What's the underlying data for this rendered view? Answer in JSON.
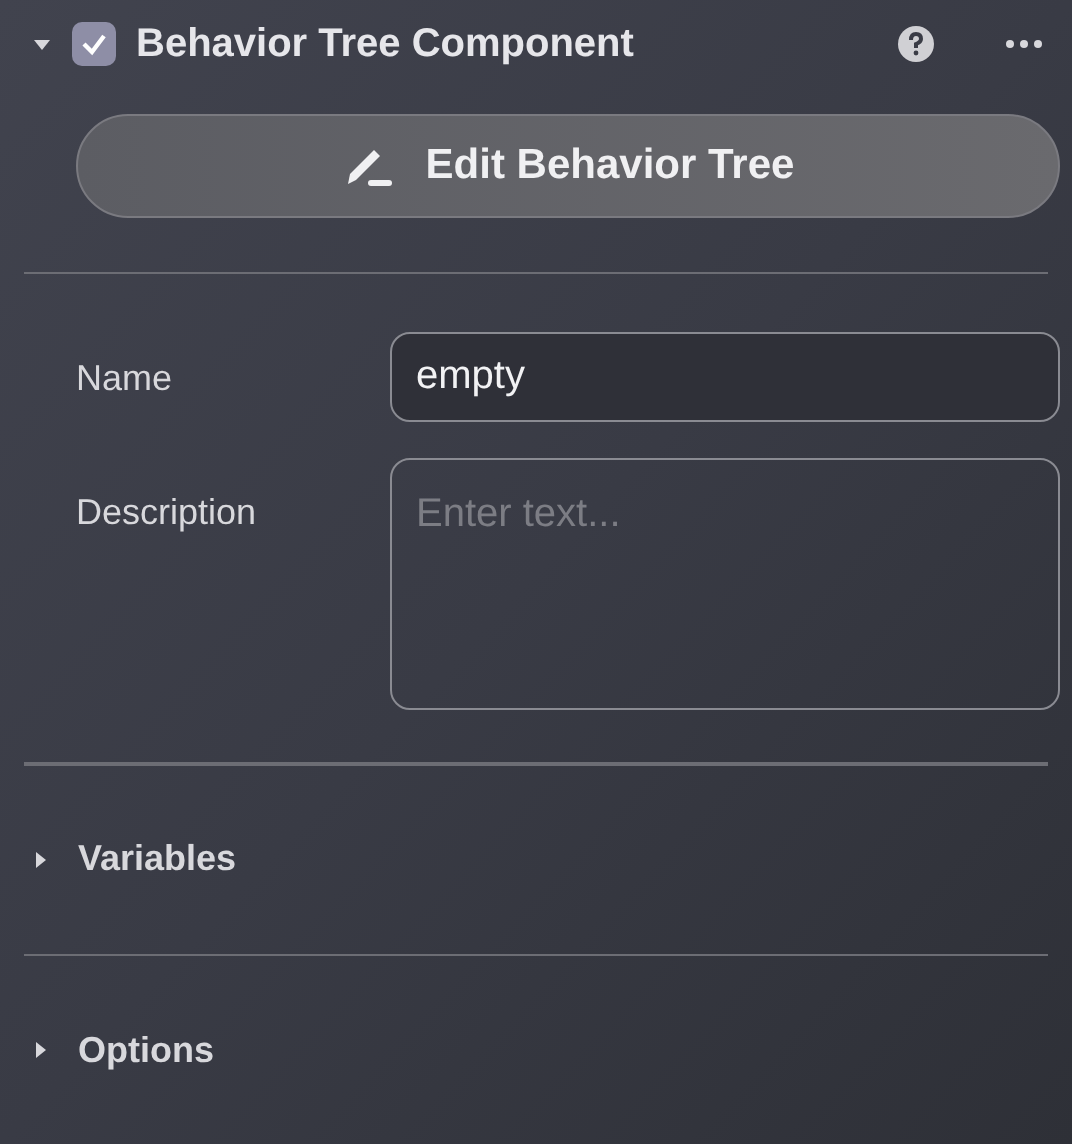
{
  "component": {
    "title": "Behavior Tree Component",
    "expanded": true,
    "enabled": true
  },
  "edit_button": {
    "label": "Edit Behavior Tree"
  },
  "fields": [
    {
      "label": "Name",
      "kind": "text",
      "value": "empty"
    },
    {
      "label": "Description",
      "kind": "textarea",
      "placeholder": "Enter text..."
    }
  ],
  "sections": [
    {
      "label": "Variables",
      "expanded": false
    },
    {
      "label": "Options",
      "expanded": false
    }
  ]
}
